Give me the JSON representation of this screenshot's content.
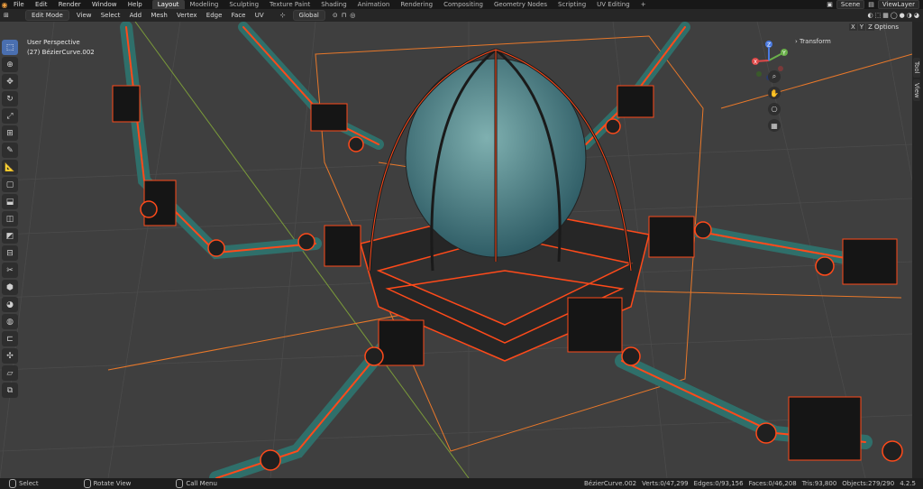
{
  "topbar": {
    "logo_icon": "blender-logo-icon",
    "menus": [
      "File",
      "Edit",
      "Render",
      "Window",
      "Help"
    ],
    "workspaces": [
      "Layout",
      "Modeling",
      "Sculpting",
      "Texture Paint",
      "Shading",
      "Animation",
      "Rendering",
      "Compositing",
      "Geometry Nodes",
      "Scripting",
      "UV Editing"
    ],
    "active_workspace": "Layout",
    "add_tab": "+",
    "scene": "Scene",
    "viewlayer": "ViewLayer"
  },
  "header": {
    "mode": "Edit Mode",
    "menus": [
      "View",
      "Select",
      "Add",
      "Mesh",
      "Vertex",
      "Edge",
      "Face",
      "UV"
    ],
    "orientation": "Global",
    "options": "Options",
    "axes": [
      "X",
      "Y",
      "Z"
    ]
  },
  "viewport": {
    "perspective": "User Perspective",
    "object": "(27) BézierCurve.002",
    "transform_label": "Transform"
  },
  "sidebar_tabs": [
    "Tool",
    "View"
  ],
  "gizmo": {
    "x": "X",
    "y": "Y",
    "z": "Z"
  },
  "status": {
    "select": "Select",
    "rotate": "Rotate View",
    "menu": "Call Menu",
    "stats": [
      "BézierCurve.002",
      "Verts:0/47,299",
      "Edges:0/93,156",
      "Faces:0/46,208",
      "Tris:93,800",
      "Objects:279/290"
    ],
    "version": "4.2.5"
  },
  "colors": {
    "accent": "#4a6fb0",
    "wire": "#ff4a1a",
    "orange": "#e8782a",
    "grid": "#4a4a4a"
  }
}
